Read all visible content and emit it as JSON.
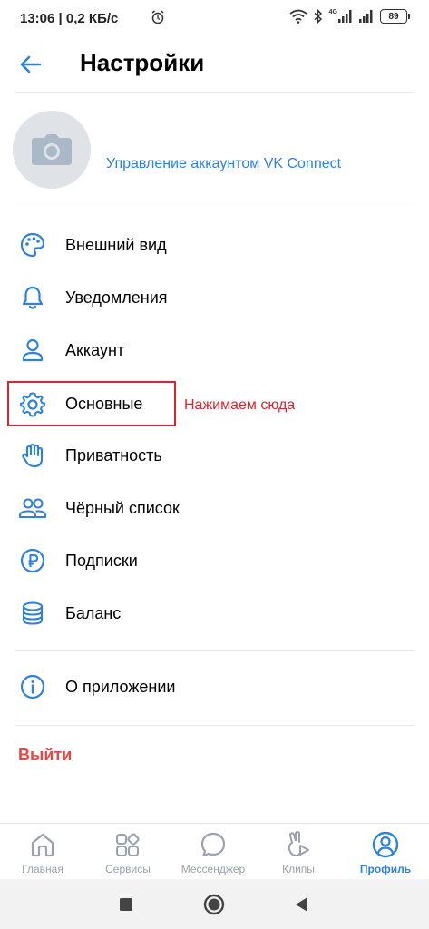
{
  "status_bar": {
    "time": "13:06 | 0,2 КБ/с",
    "network_type": "4G",
    "battery": "89"
  },
  "header": {
    "title": "Настройки"
  },
  "account": {
    "manage_link": "Управление аккаунтом VK Connect"
  },
  "menu": {
    "items": [
      {
        "label": "Внешний вид",
        "icon": "palette-icon"
      },
      {
        "label": "Уведомления",
        "icon": "bell-icon"
      },
      {
        "label": "Аккаунт",
        "icon": "user-icon"
      },
      {
        "label": "Основные",
        "icon": "gear-icon"
      },
      {
        "label": "Приватность",
        "icon": "hand-icon"
      },
      {
        "label": "Чёрный список",
        "icon": "users-icon"
      },
      {
        "label": "Подписки",
        "icon": "ruble-icon"
      },
      {
        "label": "Баланс",
        "icon": "coins-icon"
      }
    ],
    "about": {
      "label": "О приложении",
      "icon": "info-icon"
    },
    "logout_label": "Выйти"
  },
  "annotation": {
    "text": "Нажимаем сюда"
  },
  "tabbar": {
    "tabs": [
      {
        "label": "Главная",
        "icon": "home-icon",
        "active": false
      },
      {
        "label": "Сервисы",
        "icon": "services-icon",
        "active": false
      },
      {
        "label": "Мессенджер",
        "icon": "message-icon",
        "active": false
      },
      {
        "label": "Клипы",
        "icon": "clips-icon",
        "active": false
      },
      {
        "label": "Профиль",
        "icon": "profile-icon",
        "active": true
      }
    ]
  },
  "colors": {
    "accent": "#2d81e0",
    "danger": "#e64646",
    "annotation": "#d7262e",
    "inactive": "#99a2ad"
  }
}
